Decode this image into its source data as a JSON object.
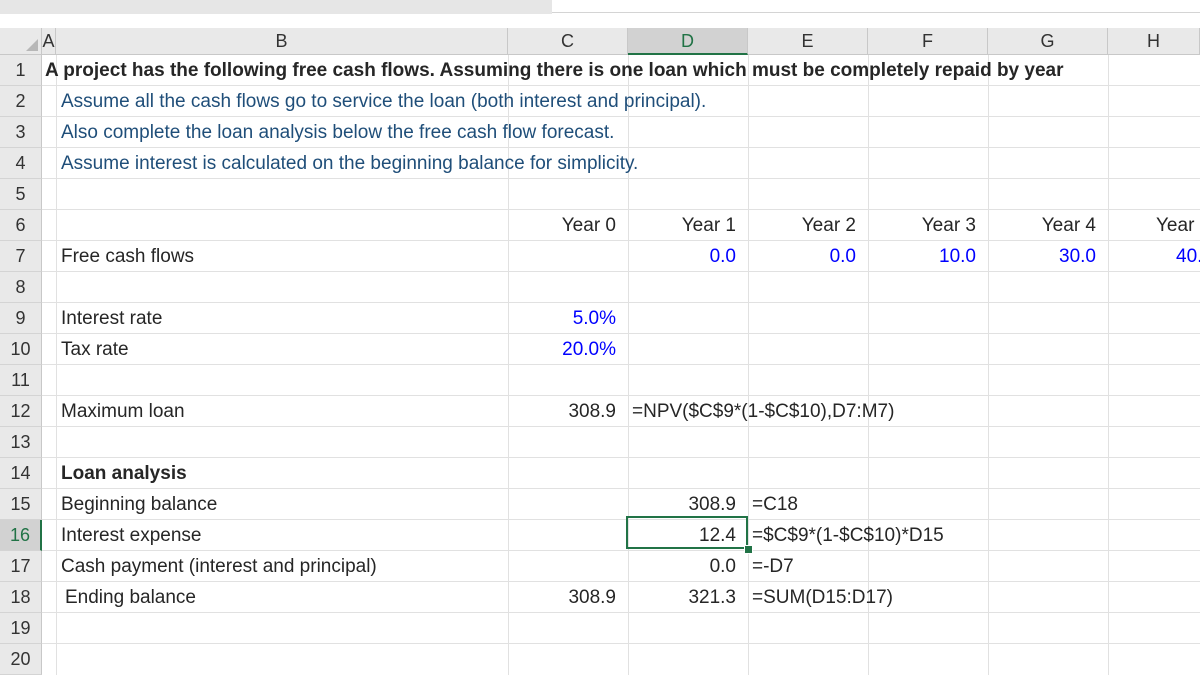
{
  "columns": [
    "A",
    "B",
    "C",
    "D",
    "E",
    "F",
    "G",
    "H"
  ],
  "rows": [
    "1",
    "2",
    "3",
    "4",
    "5",
    "6",
    "7",
    "8",
    "9",
    "10",
    "11",
    "12",
    "13",
    "14",
    "15",
    "16",
    "17",
    "18",
    "19",
    "20"
  ],
  "selected": {
    "column": "D",
    "row": "16"
  },
  "cells": {
    "A1": "A project has the following free cash flows. Assuming there is one loan which must be completely repaid by year",
    "B2": "Assume all the cash flows go to service the loan (both interest and principal).",
    "B3": "Also complete the loan analysis below the free cash flow forecast.",
    "B4": "Assume interest is calculated on the beginning balance for simplicity.",
    "C6": "Year 0",
    "D6": "Year 1",
    "E6": "Year 2",
    "F6": "Year 3",
    "G6": "Year 4",
    "H6": "Year",
    "B7": "Free cash flows",
    "D7": "0.0",
    "E7": "0.0",
    "F7": "10.0",
    "G7": "30.0",
    "H7": "40.",
    "B9": "Interest rate",
    "C9": "5.0%",
    "B10": "Tax rate",
    "C10": "20.0%",
    "B12": "Maximum loan",
    "C12": "308.9",
    "D12": "=NPV($C$9*(1-$C$10),D7:M7)",
    "B14": "Loan analysis",
    "B15": "Beginning balance",
    "D15": "308.9",
    "E15": "=C18",
    "B16": "Interest expense",
    "D16": "12.4",
    "E16": "=$C$9*(1-$C$10)*D15",
    "B17": "Cash payment (interest and principal)",
    "D17": "0.0",
    "E17": "=-D7",
    "B18": "Ending balance",
    "C18": "308.9",
    "D18": "321.3",
    "E18": "=SUM(D15:D17)"
  }
}
